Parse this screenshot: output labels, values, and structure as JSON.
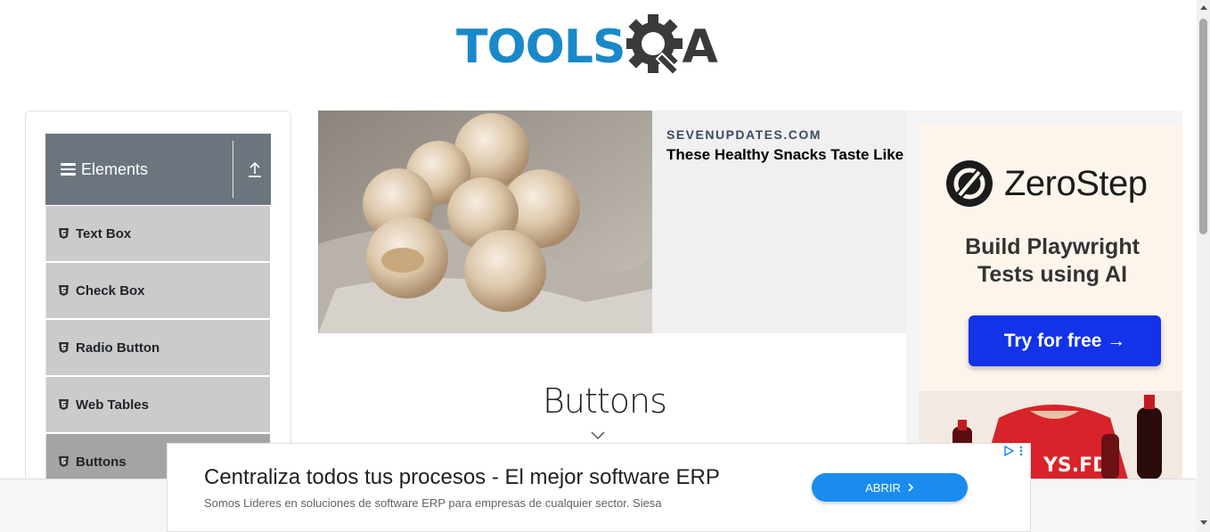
{
  "header": {
    "logo_tools": "TOOLS",
    "logo_a": "A"
  },
  "sidebar": {
    "group_title": "Elements",
    "items": [
      {
        "label": "Text Box"
      },
      {
        "label": "Check Box"
      },
      {
        "label": "Radio Button"
      },
      {
        "label": "Web Tables"
      },
      {
        "label": "Buttons",
        "active": true
      }
    ]
  },
  "ad_top": {
    "source": "SEVENUPDATES.COM",
    "headline": "These Healthy Snacks Taste Like Candy"
  },
  "ad_right": {
    "brand": "ZeroStep",
    "tagline_line1": "Build Playwright",
    "tagline_line2": "Tests using AI",
    "cta": "Try for free →",
    "accent": "#1233e8"
  },
  "main": {
    "title": "Buttons"
  },
  "ad_bottom": {
    "title": "Centraliza todos tus procesos - El mejor software ERP",
    "description": "Somos Lideres en soluciones de software ERP para empresas de cualquier sector. Siesa",
    "cta": "ABRIR",
    "accent": "#1a8cf0"
  },
  "colors": {
    "logo_blue": "#1989c9",
    "logo_dark": "#3a3a3a",
    "group_header": "#6c757d",
    "menu_item": "#cbcbcb"
  }
}
